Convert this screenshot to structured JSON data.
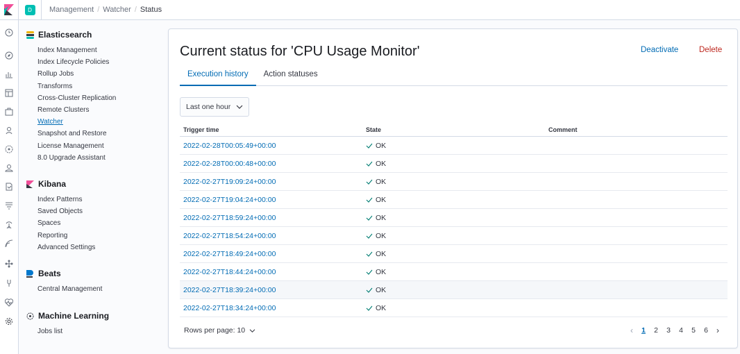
{
  "header": {
    "space_initial": "D",
    "breadcrumbs": [
      "Management",
      "Watcher",
      "Status"
    ]
  },
  "sidebar": {
    "elasticsearch": {
      "title": "Elasticsearch",
      "items": [
        "Index Management",
        "Index Lifecycle Policies",
        "Rollup Jobs",
        "Transforms",
        "Cross-Cluster Replication",
        "Remote Clusters",
        "Watcher",
        "Snapshot and Restore",
        "License Management",
        "8.0 Upgrade Assistant"
      ],
      "active_item": "Watcher"
    },
    "kibana": {
      "title": "Kibana",
      "items": [
        "Index Patterns",
        "Saved Objects",
        "Spaces",
        "Reporting",
        "Advanced Settings"
      ]
    },
    "beats": {
      "title": "Beats",
      "items": [
        "Central Management"
      ]
    },
    "ml": {
      "title": "Machine Learning",
      "items": [
        "Jobs list"
      ]
    }
  },
  "main": {
    "title": "Current status for 'CPU Usage Monitor'",
    "deactivate_label": "Deactivate",
    "delete_label": "Delete",
    "tabs": [
      {
        "label": "Execution history",
        "active": true
      },
      {
        "label": "Action statuses",
        "active": false
      }
    ],
    "time_range": "Last one hour",
    "table": {
      "columns": [
        "Trigger time",
        "State",
        "Comment"
      ],
      "rows": [
        {
          "trigger_time": "2022-02-28T00:05:49+00:00",
          "state": "OK",
          "comment": ""
        },
        {
          "trigger_time": "2022-02-28T00:00:48+00:00",
          "state": "OK",
          "comment": ""
        },
        {
          "trigger_time": "2022-02-27T19:09:24+00:00",
          "state": "OK",
          "comment": ""
        },
        {
          "trigger_time": "2022-02-27T19:04:24+00:00",
          "state": "OK",
          "comment": ""
        },
        {
          "trigger_time": "2022-02-27T18:59:24+00:00",
          "state": "OK",
          "comment": ""
        },
        {
          "trigger_time": "2022-02-27T18:54:24+00:00",
          "state": "OK",
          "comment": ""
        },
        {
          "trigger_time": "2022-02-27T18:49:24+00:00",
          "state": "OK",
          "comment": ""
        },
        {
          "trigger_time": "2022-02-27T18:44:24+00:00",
          "state": "OK",
          "comment": ""
        },
        {
          "trigger_time": "2022-02-27T18:39:24+00:00",
          "state": "OK",
          "comment": ""
        },
        {
          "trigger_time": "2022-02-27T18:34:24+00:00",
          "state": "OK",
          "comment": ""
        }
      ]
    },
    "pagination": {
      "rows_per_page_label": "Rows per page: 10",
      "pages": [
        "1",
        "2",
        "3",
        "4",
        "5",
        "6"
      ],
      "current_page": "1"
    }
  },
  "colors": {
    "link": "#006bb4",
    "danger": "#bd271e",
    "ok_check": "#017d73",
    "space_avatar": "#00bfb3"
  },
  "rail_icons": [
    "clock-icon",
    "compass-icon",
    "visualize-icon",
    "dashboard-icon",
    "canvas-icon",
    "maps-icon",
    "ml-icon",
    "user-icon",
    "siem-icon",
    "logs-icon",
    "apm-icon",
    "uptime-icon",
    "graph-icon",
    "dev-tools-icon",
    "heartbeat-icon",
    "gear-icon"
  ]
}
